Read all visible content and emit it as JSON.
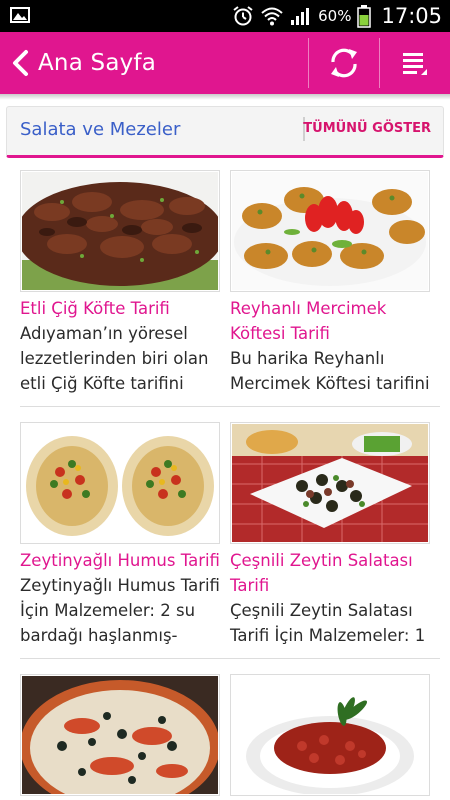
{
  "status_bar": {
    "battery": "60%",
    "time": "17:05",
    "icons": [
      "image-icon",
      "alarm-icon",
      "wifi-icon",
      "signal-icon",
      "battery-icon"
    ]
  },
  "app_bar": {
    "title": "Ana Sayfa",
    "color": "#e0168f",
    "icons": [
      "back-chevron-icon",
      "refresh-icon",
      "menu-icon"
    ]
  },
  "section": {
    "title": "Salata ve Mezeler",
    "show_all": "TÜMÜNÜ GÖSTER"
  },
  "recipes": [
    {
      "title": "Etli Çiğ Köfte Tarifi",
      "desc": "Adıyaman’ın yöresel lezzetlerinden biri olan etli Çiğ Köfte tarifini"
    },
    {
      "title": "Reyhanlı Mercimek Köftesi Tarifi",
      "desc": "Bu harika Reyhanlı Mercimek Köftesi tarifini"
    },
    {
      "title": "Zeytinyağlı Humus Tarifi",
      "desc": "Zeytinyağlı Humus Tarifi İçin Malzemeler: 2 su bardağı haşlanmış-"
    },
    {
      "title": "Çeşnili Zeytin Salatası Tarifi",
      "desc": "Çeşnili Zeytin Salatası Tarifi İçin Malzemeler: 1"
    },
    {
      "title": "",
      "desc": ""
    },
    {
      "title": "",
      "desc": ""
    }
  ]
}
